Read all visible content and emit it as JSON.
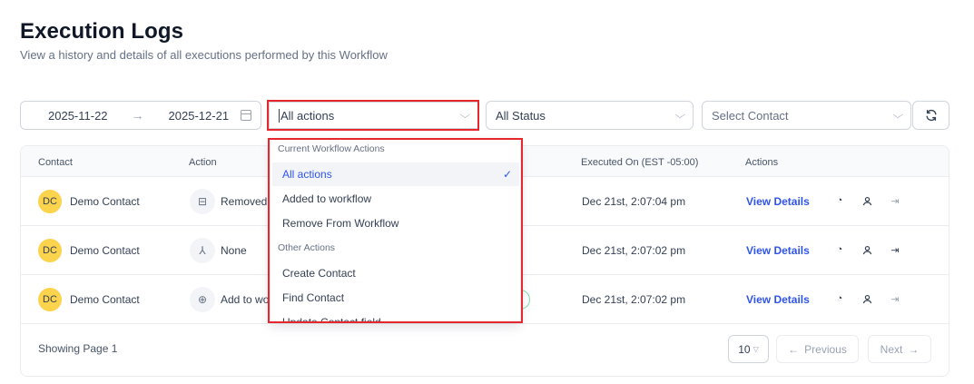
{
  "header": {
    "title": "Execution Logs",
    "subtitle": "View a history and details of all executions performed by this Workflow"
  },
  "filters": {
    "date_start": "2025-11-22",
    "date_end": "2025-12-21",
    "action_value": "All actions",
    "status_value": "All Status",
    "contact_placeholder": "Select Contact"
  },
  "table": {
    "columns": {
      "contact": "Contact",
      "action": "Action",
      "executed_on": "Executed On (EST -05:00)",
      "actions": "Actions"
    },
    "rows": [
      {
        "initials": "DC",
        "contact": "Demo Contact",
        "action": "Removed",
        "executed": "Dec 21st, 2:07:04 pm",
        "view": "View Details"
      },
      {
        "initials": "DC",
        "contact": "Demo Contact",
        "action": "None",
        "executed": "Dec 21st, 2:07:02 pm",
        "view": "View Details"
      },
      {
        "initials": "DC",
        "contact": "Demo Contact",
        "action": "Add to wo",
        "executed": "Dec 21st, 2:07:02 pm",
        "view": "View Details"
      }
    ]
  },
  "footer": {
    "showing": "Showing Page 1",
    "per_page": "10",
    "prev": "Previous",
    "next": "Next"
  },
  "dropdown": {
    "group1": "Current Workflow Actions",
    "group2": "Other Actions",
    "options": [
      "All actions",
      "Added to workflow",
      "Remove From Workflow",
      "Create Contact",
      "Find Contact",
      "Update Contact field"
    ],
    "selected": "All actions"
  },
  "icons": [
    "calendar-icon",
    "chevron-down-icon",
    "refresh-icon",
    "remove-icon",
    "branch-icon",
    "add-circle-icon",
    "history-icon",
    "user-icon",
    "exit-icon",
    "check-icon",
    "arrow-left-icon",
    "arrow-right-icon"
  ],
  "colors": {
    "accent": "#2f54eb",
    "highlight": "#e6282e",
    "avatar": "#fcd34d"
  }
}
